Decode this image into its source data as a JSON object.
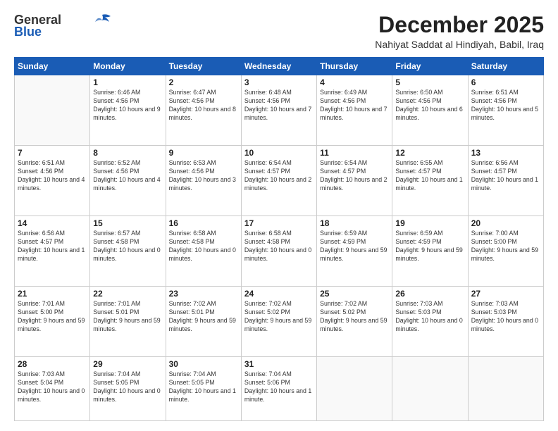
{
  "header": {
    "logo_general": "General",
    "logo_blue": "Blue",
    "month": "December 2025",
    "location": "Nahiyat Saddat al Hindiyah, Babil, Iraq"
  },
  "weekdays": [
    "Sunday",
    "Monday",
    "Tuesday",
    "Wednesday",
    "Thursday",
    "Friday",
    "Saturday"
  ],
  "weeks": [
    [
      null,
      {
        "day": 1,
        "sunrise": "Sunrise: 6:46 AM",
        "sunset": "Sunset: 4:56 PM",
        "daylight": "Daylight: 10 hours and 9 minutes."
      },
      {
        "day": 2,
        "sunrise": "Sunrise: 6:47 AM",
        "sunset": "Sunset: 4:56 PM",
        "daylight": "Daylight: 10 hours and 8 minutes."
      },
      {
        "day": 3,
        "sunrise": "Sunrise: 6:48 AM",
        "sunset": "Sunset: 4:56 PM",
        "daylight": "Daylight: 10 hours and 7 minutes."
      },
      {
        "day": 4,
        "sunrise": "Sunrise: 6:49 AM",
        "sunset": "Sunset: 4:56 PM",
        "daylight": "Daylight: 10 hours and 7 minutes."
      },
      {
        "day": 5,
        "sunrise": "Sunrise: 6:50 AM",
        "sunset": "Sunset: 4:56 PM",
        "daylight": "Daylight: 10 hours and 6 minutes."
      },
      {
        "day": 6,
        "sunrise": "Sunrise: 6:51 AM",
        "sunset": "Sunset: 4:56 PM",
        "daylight": "Daylight: 10 hours and 5 minutes."
      }
    ],
    [
      {
        "day": 7,
        "sunrise": "Sunrise: 6:51 AM",
        "sunset": "Sunset: 4:56 PM",
        "daylight": "Daylight: 10 hours and 4 minutes."
      },
      {
        "day": 8,
        "sunrise": "Sunrise: 6:52 AM",
        "sunset": "Sunset: 4:56 PM",
        "daylight": "Daylight: 10 hours and 4 minutes."
      },
      {
        "day": 9,
        "sunrise": "Sunrise: 6:53 AM",
        "sunset": "Sunset: 4:56 PM",
        "daylight": "Daylight: 10 hours and 3 minutes."
      },
      {
        "day": 10,
        "sunrise": "Sunrise: 6:54 AM",
        "sunset": "Sunset: 4:57 PM",
        "daylight": "Daylight: 10 hours and 2 minutes."
      },
      {
        "day": 11,
        "sunrise": "Sunrise: 6:54 AM",
        "sunset": "Sunset: 4:57 PM",
        "daylight": "Daylight: 10 hours and 2 minutes."
      },
      {
        "day": 12,
        "sunrise": "Sunrise: 6:55 AM",
        "sunset": "Sunset: 4:57 PM",
        "daylight": "Daylight: 10 hours and 1 minute."
      },
      {
        "day": 13,
        "sunrise": "Sunrise: 6:56 AM",
        "sunset": "Sunset: 4:57 PM",
        "daylight": "Daylight: 10 hours and 1 minute."
      }
    ],
    [
      {
        "day": 14,
        "sunrise": "Sunrise: 6:56 AM",
        "sunset": "Sunset: 4:57 PM",
        "daylight": "Daylight: 10 hours and 1 minute."
      },
      {
        "day": 15,
        "sunrise": "Sunrise: 6:57 AM",
        "sunset": "Sunset: 4:58 PM",
        "daylight": "Daylight: 10 hours and 0 minutes."
      },
      {
        "day": 16,
        "sunrise": "Sunrise: 6:58 AM",
        "sunset": "Sunset: 4:58 PM",
        "daylight": "Daylight: 10 hours and 0 minutes."
      },
      {
        "day": 17,
        "sunrise": "Sunrise: 6:58 AM",
        "sunset": "Sunset: 4:58 PM",
        "daylight": "Daylight: 10 hours and 0 minutes."
      },
      {
        "day": 18,
        "sunrise": "Sunrise: 6:59 AM",
        "sunset": "Sunset: 4:59 PM",
        "daylight": "Daylight: 9 hours and 59 minutes."
      },
      {
        "day": 19,
        "sunrise": "Sunrise: 6:59 AM",
        "sunset": "Sunset: 4:59 PM",
        "daylight": "Daylight: 9 hours and 59 minutes."
      },
      {
        "day": 20,
        "sunrise": "Sunrise: 7:00 AM",
        "sunset": "Sunset: 5:00 PM",
        "daylight": "Daylight: 9 hours and 59 minutes."
      }
    ],
    [
      {
        "day": 21,
        "sunrise": "Sunrise: 7:01 AM",
        "sunset": "Sunset: 5:00 PM",
        "daylight": "Daylight: 9 hours and 59 minutes."
      },
      {
        "day": 22,
        "sunrise": "Sunrise: 7:01 AM",
        "sunset": "Sunset: 5:01 PM",
        "daylight": "Daylight: 9 hours and 59 minutes."
      },
      {
        "day": 23,
        "sunrise": "Sunrise: 7:02 AM",
        "sunset": "Sunset: 5:01 PM",
        "daylight": "Daylight: 9 hours and 59 minutes."
      },
      {
        "day": 24,
        "sunrise": "Sunrise: 7:02 AM",
        "sunset": "Sunset: 5:02 PM",
        "daylight": "Daylight: 9 hours and 59 minutes."
      },
      {
        "day": 25,
        "sunrise": "Sunrise: 7:02 AM",
        "sunset": "Sunset: 5:02 PM",
        "daylight": "Daylight: 9 hours and 59 minutes."
      },
      {
        "day": 26,
        "sunrise": "Sunrise: 7:03 AM",
        "sunset": "Sunset: 5:03 PM",
        "daylight": "Daylight: 10 hours and 0 minutes."
      },
      {
        "day": 27,
        "sunrise": "Sunrise: 7:03 AM",
        "sunset": "Sunset: 5:03 PM",
        "daylight": "Daylight: 10 hours and 0 minutes."
      }
    ],
    [
      {
        "day": 28,
        "sunrise": "Sunrise: 7:03 AM",
        "sunset": "Sunset: 5:04 PM",
        "daylight": "Daylight: 10 hours and 0 minutes."
      },
      {
        "day": 29,
        "sunrise": "Sunrise: 7:04 AM",
        "sunset": "Sunset: 5:05 PM",
        "daylight": "Daylight: 10 hours and 0 minutes."
      },
      {
        "day": 30,
        "sunrise": "Sunrise: 7:04 AM",
        "sunset": "Sunset: 5:05 PM",
        "daylight": "Daylight: 10 hours and 1 minute."
      },
      {
        "day": 31,
        "sunrise": "Sunrise: 7:04 AM",
        "sunset": "Sunset: 5:06 PM",
        "daylight": "Daylight: 10 hours and 1 minute."
      },
      null,
      null,
      null
    ]
  ]
}
